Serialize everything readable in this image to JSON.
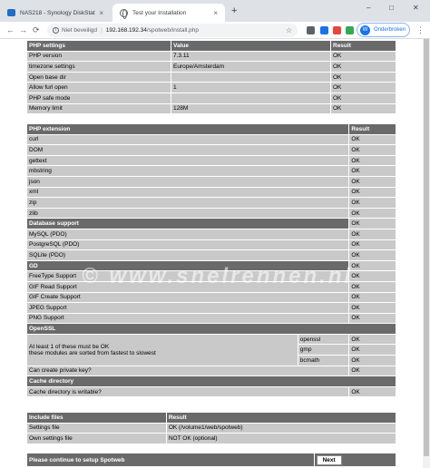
{
  "browser": {
    "tabs": [
      {
        "title": "NAS218 - Synology DiskStation",
        "close": "×"
      },
      {
        "title": "Test your Installation",
        "close": "×"
      }
    ],
    "new_tab": "+",
    "window_controls": {
      "minimize": "–",
      "maximize": "□",
      "close": "✕"
    },
    "nav": {
      "back": "←",
      "forward": "→",
      "reload": "⟳"
    },
    "security_label": "Niet beveiligd",
    "url_host": "192.168.192.34",
    "url_path": "/spotweb/install.php",
    "star": "☆",
    "profile_initial": "W",
    "profile_label": "Onderbroken",
    "menu": "⋮"
  },
  "settings": {
    "headers": [
      "PHP settings",
      "Value",
      "Result"
    ],
    "rows": [
      {
        "name": "PHP version",
        "value": "7.3.11",
        "result": "OK"
      },
      {
        "name": "timezone settings",
        "value": "Europe/Amsterdam",
        "result": "OK"
      },
      {
        "name": "Open base dir",
        "value": "",
        "result": "OK"
      },
      {
        "name": "Allow furl open",
        "value": "1",
        "result": "OK"
      },
      {
        "name": "PHP safe mode",
        "value": "",
        "result": "OK"
      },
      {
        "name": "Memory limit",
        "value": "128M",
        "result": "OK"
      }
    ]
  },
  "extensions": {
    "header": "PHP extension",
    "result_header": "Result",
    "rows": [
      {
        "name": "curl",
        "result": "OK"
      },
      {
        "name": "DOM",
        "result": "OK"
      },
      {
        "name": "gettext",
        "result": "OK"
      },
      {
        "name": "mbstring",
        "result": "OK"
      },
      {
        "name": "json",
        "result": "OK"
      },
      {
        "name": "xml",
        "result": "OK"
      },
      {
        "name": "zip",
        "result": "OK"
      },
      {
        "name": "zlib",
        "result": "OK"
      }
    ],
    "database_header": "Database support",
    "database_result": "OK",
    "database_rows": [
      {
        "name": "MySQL (PDO)",
        "result": "OK"
      },
      {
        "name": "PostgreSQL (PDO)",
        "result": "OK"
      },
      {
        "name": "SQLite (PDO)",
        "result": "OK"
      }
    ],
    "gd_header": "GD",
    "gd_result": "OK",
    "gd_rows": [
      {
        "name": "FreeType Support",
        "result": "OK"
      },
      {
        "name": "GIF Read Support",
        "result": "OK"
      },
      {
        "name": "GIF Create Support",
        "result": "OK"
      },
      {
        "name": "JPEG Support",
        "result": "OK"
      },
      {
        "name": "PNG Support",
        "result": "OK"
      }
    ],
    "openssl_header": "OpenSSL",
    "openssl_note_1": "At least 1 of these must be OK",
    "openssl_note_2": "these modules are sorted from fastest to slowest",
    "openssl_rows": [
      {
        "name": "openssl",
        "result": "OK"
      },
      {
        "name": "gmp",
        "result": "OK"
      },
      {
        "name": "bcmath",
        "result": "OK"
      }
    ],
    "private_key": {
      "name": "Can create private key?",
      "result": "OK"
    },
    "cache_header": "Cache directory",
    "cache_row": {
      "name": "Cache directory is writable?",
      "result": "OK"
    }
  },
  "include_files": {
    "headers": [
      "Include files",
      "Result"
    ],
    "rows": [
      {
        "name": "Settings file",
        "result": "OK (/volume1/web/spotweb)"
      },
      {
        "name": "Own settings file",
        "result": "NOT OK (optional)"
      }
    ]
  },
  "continue": {
    "label": "Please continue to setup Spotweb",
    "button": "Next"
  },
  "watermark": "© www.snelrennen.nl",
  "colors": {
    "header_bg": "#6a6a6a",
    "row_bg": "#c9c9c9",
    "tabstrip_bg": "#dee1e6",
    "accent": "#1a73e8"
  }
}
